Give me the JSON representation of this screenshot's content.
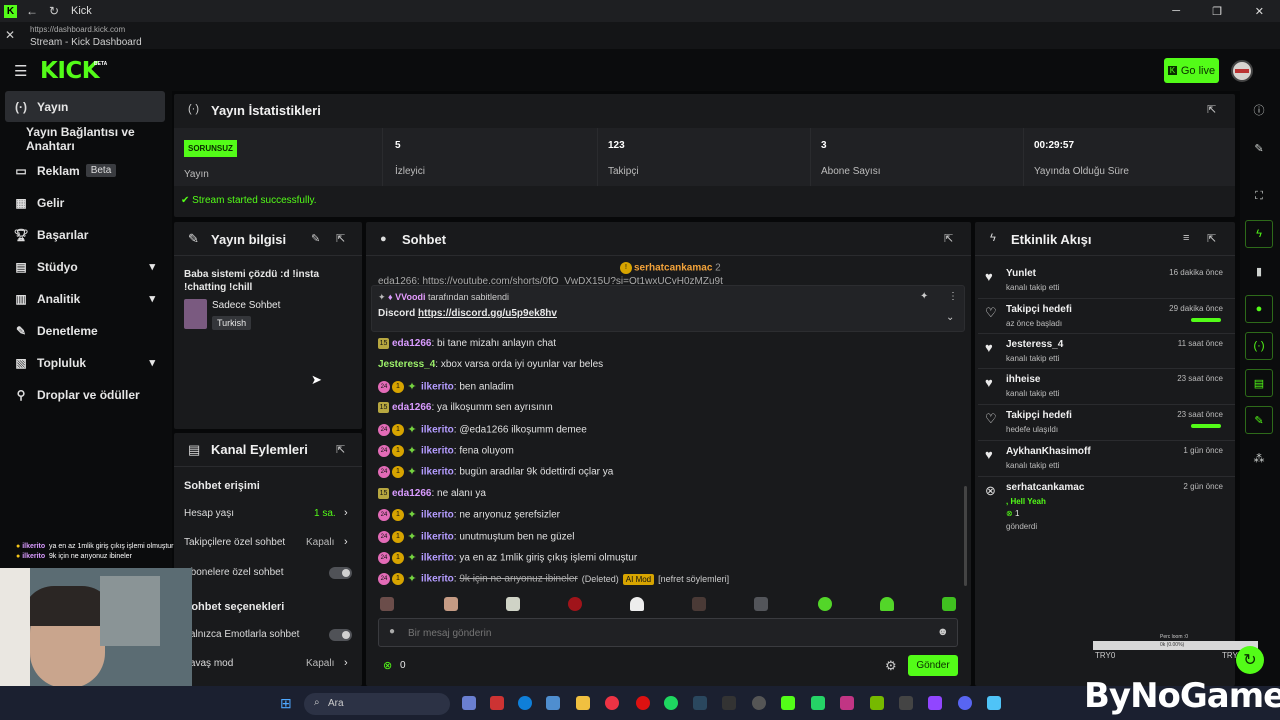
{
  "window": {
    "title": "Kick"
  },
  "urlbar": {
    "url": "https://dashboard.kick.com",
    "page_title": "Stream - Kick Dashboard"
  },
  "header": {
    "logo": "KICK",
    "beta": "BETA",
    "go_live": "Go live"
  },
  "sidebar": {
    "items": [
      {
        "label": "Yayın",
        "icon": "broadcast-icon"
      },
      {
        "label": "Yayın Bağlantısı ve Anahtarı",
        "icon": ""
      },
      {
        "label": "Reklam",
        "badge": "Beta",
        "icon": "ad-icon"
      },
      {
        "label": "Gelir",
        "icon": "revenue-icon"
      },
      {
        "label": "Başarılar",
        "icon": "trophy-icon"
      },
      {
        "label": "Stüdyo",
        "icon": "studio-icon"
      },
      {
        "label": "Analitik",
        "icon": "analytics-icon"
      },
      {
        "label": "Denetleme",
        "icon": "wrench-icon"
      },
      {
        "label": "Topluluk",
        "icon": "community-icon"
      },
      {
        "label": "Droplar ve ödüller",
        "icon": "gift-icon"
      }
    ]
  },
  "stats": {
    "title": "Yayın İstatistikleri",
    "cells": [
      {
        "value": "SORUNSUZ",
        "label": "Yayın"
      },
      {
        "value": "5",
        "label": "İzleyici"
      },
      {
        "value": "123",
        "label": "Takipçi"
      },
      {
        "value": "3",
        "label": "Abone Sayısı"
      },
      {
        "value": "00:29:57",
        "label": "Yayında Olduğu Süre"
      }
    ],
    "status": "Stream started successfully."
  },
  "info": {
    "title": "Yayın bilgisi",
    "stream_title": "Baba sistemi çözdü :d !insta !chatting !chill",
    "category": "Sadece Sohbet",
    "language": "Turkish"
  },
  "actions": {
    "title": "Kanal Eylemleri",
    "chat_access": "Sohbet erişimi",
    "rows": [
      {
        "label": "Hesap yaşı",
        "value": "1 sa."
      },
      {
        "label": "Takipçilere özel sohbet",
        "value": "Kapalı"
      },
      {
        "label": "Abonelere özel sohbet",
        "value": ""
      }
    ],
    "options": "Sohbet seçenekleri",
    "opt_rows": [
      {
        "label": "Yalnızca Emotlarla sohbet",
        "value": ""
      },
      {
        "label": "Yavaş mod",
        "value": "Kapalı"
      }
    ]
  },
  "chat": {
    "title": "Sohbet",
    "top_user": "serhatcankamac",
    "top_count": "2",
    "partial_msg": "eda1266: https://youtube.com/shorts/0fO_VwDX15U?si=Ot1wxUCvH0zMZu9t",
    "pinned_by": "VVoodi",
    "pinned_text": "tarafından sabitlendi",
    "pinned_label": "Discord",
    "pinned_link": "https://discord.gg/u5p9ek8hv",
    "messages": [
      {
        "badges": [
          "15"
        ],
        "user": "eda1266",
        "cls": "u-eda",
        "text": "bi tane mizahı anlayın chat"
      },
      {
        "badges": [],
        "user": "Jesteress_4",
        "cls": "u-jes",
        "text": "xbox varsa orda iyi oyunlar var beles"
      },
      {
        "badges": [
          "24",
          "1",
          "g"
        ],
        "user": "ilkerito",
        "cls": "u-ilk",
        "text": "ben anladim"
      },
      {
        "badges": [
          "15"
        ],
        "user": "eda1266",
        "cls": "u-eda",
        "text": "ya ilkoşumm sen ayrısının"
      },
      {
        "badges": [
          "24",
          "1",
          "g"
        ],
        "user": "ilkerito",
        "cls": "u-ilk",
        "text": "@eda1266 ilkoşumm demee"
      },
      {
        "badges": [
          "24",
          "1",
          "g"
        ],
        "user": "ilkerito",
        "cls": "u-ilk",
        "text": "fena oluyom"
      },
      {
        "badges": [
          "24",
          "1",
          "g"
        ],
        "user": "ilkerito",
        "cls": "u-ilk",
        "text": "bugün aradılar 9k ödettirdi oçlar ya"
      },
      {
        "badges": [
          "15"
        ],
        "user": "eda1266",
        "cls": "u-eda",
        "text": "ne alanı ya"
      },
      {
        "badges": [
          "24",
          "1",
          "g"
        ],
        "user": "ilkerito",
        "cls": "u-ilk",
        "text": "ne arıyonuz şerefsizler"
      },
      {
        "badges": [
          "24",
          "1",
          "g"
        ],
        "user": "ilkerito",
        "cls": "u-ilk",
        "text": "unutmuştum ben ne güzel"
      },
      {
        "badges": [
          "24",
          "1",
          "g"
        ],
        "user": "ilkerito",
        "cls": "u-ilk",
        "text": "ya en az 1mlik giriş çıkış işlemi olmuştur"
      },
      {
        "badges": [
          "24",
          "1",
          "g"
        ],
        "user": "ilkerito",
        "cls": "u-ilk",
        "text": "9k için ne arıyonuz ibineler",
        "deleted": "(Deleted)",
        "mod": "AI Mod",
        "note": "[nefret söylemleri]"
      }
    ],
    "placeholder": "Bir mesaj gönderin",
    "points": "0",
    "send": "Gönder"
  },
  "events": {
    "title": "Etkinlik Akışı",
    "items": [
      {
        "title": "Yunlet",
        "sub": "kanalı takip etti",
        "time": "16 dakika önce",
        "icon": "heart-filled-icon"
      },
      {
        "title": "Takipçi hedefi",
        "sub": "az önce başladı",
        "time": "29 dakika önce",
        "icon": "heart-outline-icon",
        "progress": 1
      },
      {
        "title": "Jesteress_4",
        "sub": "kanalı takip etti",
        "time": "11 saat önce",
        "icon": "heart-filled-icon"
      },
      {
        "title": "ihheise",
        "sub": "kanalı takip etti",
        "time": "23 saat önce",
        "icon": "heart-filled-icon"
      },
      {
        "title": "Takipçi hedefi",
        "sub": "hedefe ulaşıldı",
        "time": "23 saat önce",
        "icon": "heart-outline-icon",
        "progress": 1
      },
      {
        "title": "AykhanKhasimoff",
        "sub": "kanalı takip etti",
        "time": "1 gün önce",
        "icon": "heart-filled-icon"
      },
      {
        "title": "serhatcankamac",
        "sub": "gönderdi",
        "time": "2 gün önce",
        "icon": "kick-points-icon",
        "extra": ", Hell Yeah",
        "amount": "1"
      }
    ]
  },
  "overlay": {
    "lines": [
      {
        "user": "ilkerito",
        "text": "ya en az 1mlik giriş çıkış işlemi olmuştur"
      },
      {
        "user": "ilkerito",
        "text": "9k için ne arıyonuz ibineler"
      }
    ],
    "perf_label": "Perc loom :0",
    "perf_value": "0k (0.00%)",
    "ticker_left": "TRY0",
    "ticker_right": "TRY0",
    "watermark": "ByNoGame"
  },
  "taskbar": {
    "search": "Ara"
  }
}
